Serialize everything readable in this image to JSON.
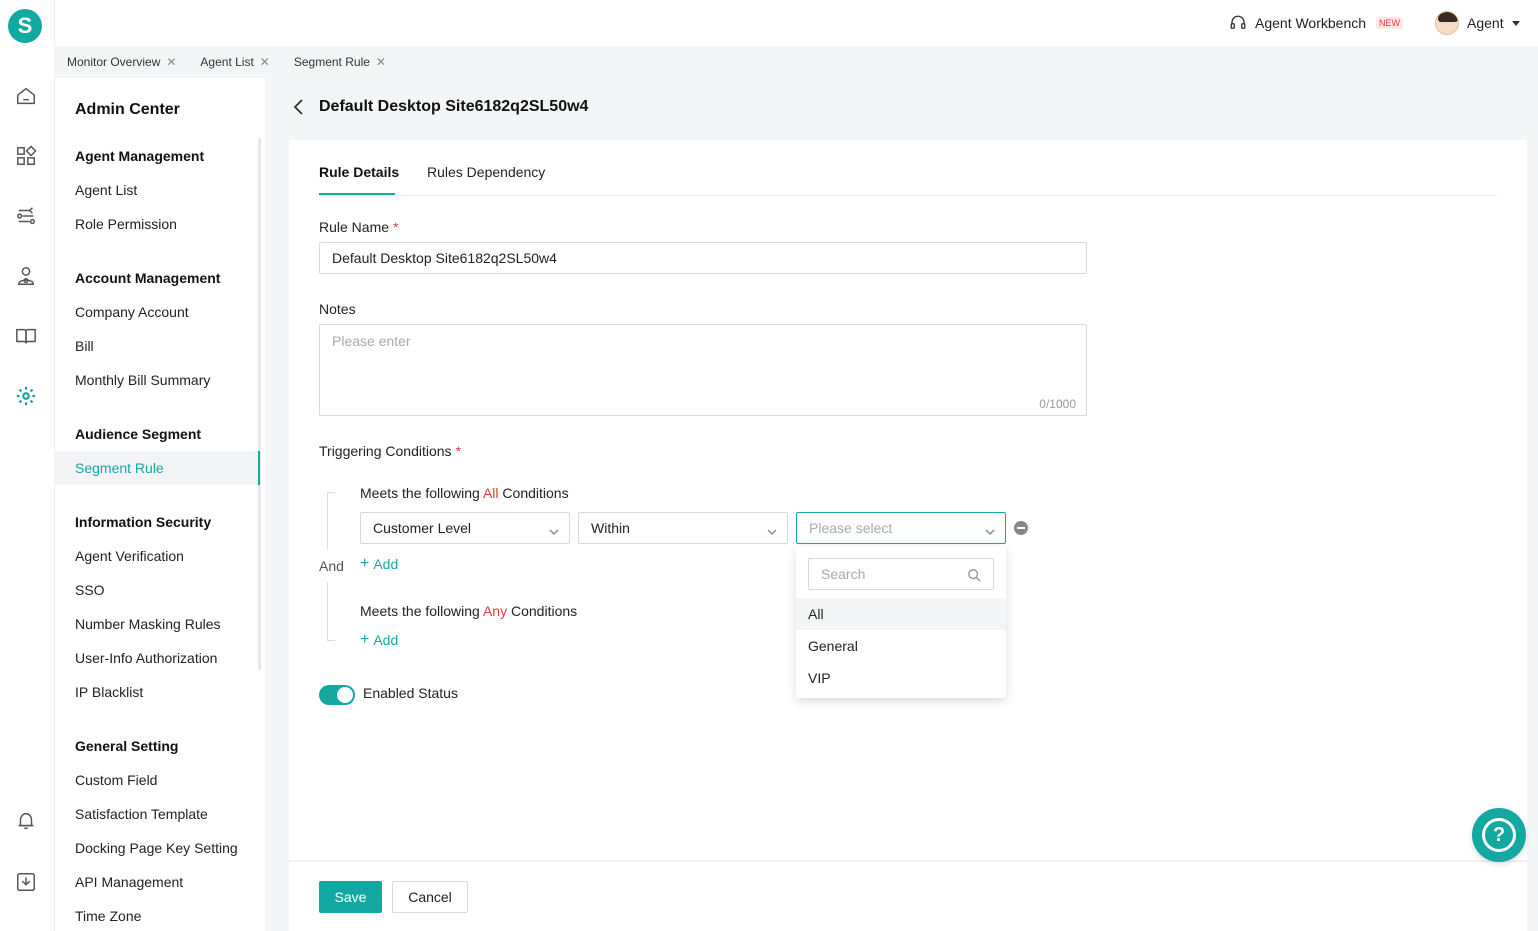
{
  "brand": {
    "logo_letter": "S",
    "accent": "#14a8a3"
  },
  "rail": [
    {
      "icon": "home-icon"
    },
    {
      "icon": "apps-grid-icon"
    },
    {
      "icon": "routing-icon"
    },
    {
      "icon": "users-icon"
    },
    {
      "icon": "book-icon"
    },
    {
      "icon": "gear-icon",
      "active": true
    },
    {
      "icon": "bell-icon"
    },
    {
      "icon": "download-icon"
    }
  ],
  "header": {
    "workbench_label": "Agent Workbench",
    "workbench_badge": "NEW",
    "user_name": "Agent"
  },
  "page_tabs": [
    {
      "label": "Monitor Overview"
    },
    {
      "label": "Agent List"
    },
    {
      "label": "Segment Rule"
    }
  ],
  "sidebar": {
    "title": "Admin Center",
    "sections": {
      "agent": "Agent Management",
      "account": "Account Management",
      "audience": "Audience Segment",
      "security": "Information Security",
      "general": "General Setting"
    },
    "items": {
      "agent_list": "Agent List",
      "role_permission": "Role Permission",
      "company_account": "Company Account",
      "bill": "Bill",
      "monthly_bill": "Monthly Bill Summary",
      "segment_rule": "Segment Rule",
      "agent_verification": "Agent Verification",
      "sso": "SSO",
      "number_masking": "Number Masking Rules",
      "user_info_auth": "User-Info Authorization",
      "ip_blacklist": "IP Blacklist",
      "custom_field": "Custom Field",
      "satisfaction_template": "Satisfaction Template",
      "docking_page": "Docking Page Key Setting",
      "api_management": "API Management",
      "time_zone": "Time Zone"
    }
  },
  "main": {
    "title": "Default Desktop Site6182q2SL50w4",
    "tabs": {
      "details": "Rule Details",
      "dependency": "Rules Dependency"
    },
    "rule_name_label": "Rule Name",
    "required_mark": "*",
    "rule_name_value": "Default Desktop Site6182q2SL50w4",
    "notes_label": "Notes",
    "notes_placeholder": "Please enter",
    "notes_counter": "0/1000",
    "triggering_label": "Triggering Conditions",
    "all_prefix": "Meets the following ",
    "all_word": "All",
    "any_word": "Any",
    "conditions_suffix": " Conditions",
    "and_label": "And",
    "add_label": "Add",
    "cond_field": "Customer Level",
    "cond_operator": "Within",
    "cond_value_placeholder": "Please select",
    "enabled_label": "Enabled Status",
    "enabled": true
  },
  "dropdown": {
    "search_placeholder": "Search",
    "options": [
      "All",
      "General",
      "VIP"
    ]
  },
  "footer": {
    "save": "Save",
    "cancel": "Cancel"
  },
  "help_label": "?"
}
